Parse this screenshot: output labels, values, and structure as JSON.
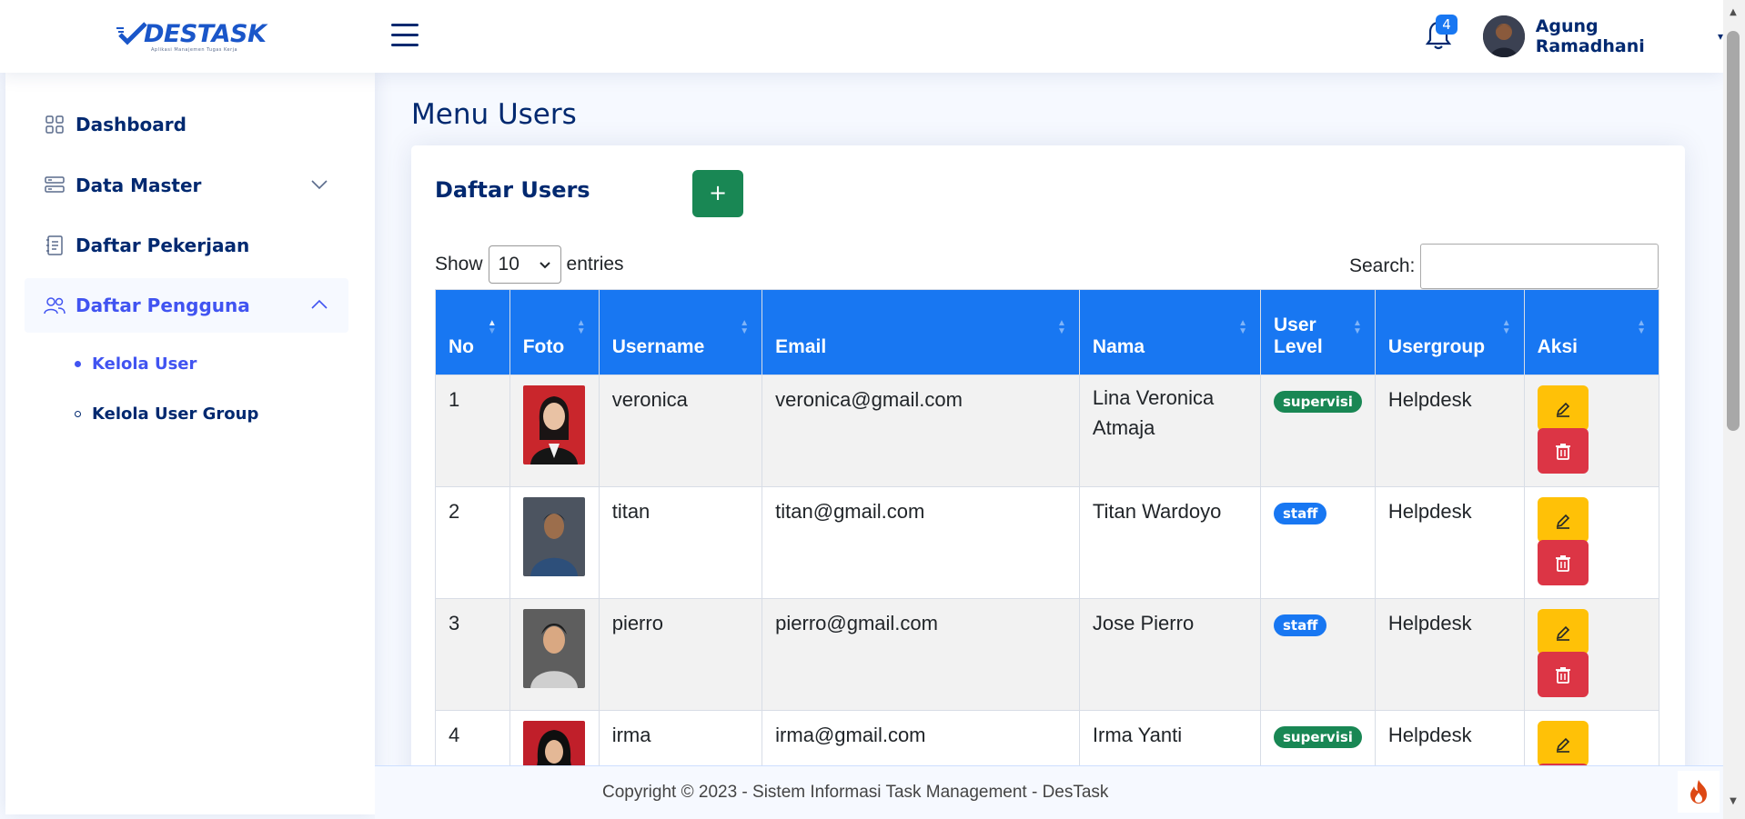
{
  "header": {
    "logo_text": "DESTASK",
    "logo_subtitle": "Aplikasi Manajemen Tugas Kerja",
    "notification_count": "4",
    "user_name": "Agung Ramadhani"
  },
  "sidebar": {
    "items": [
      {
        "label": "Dashboard",
        "icon": "grid-icon"
      },
      {
        "label": "Data Master",
        "icon": "server-icon"
      },
      {
        "label": "Daftar Pekerjaan",
        "icon": "journal-icon"
      },
      {
        "label": "Daftar Pengguna",
        "icon": "people-icon"
      }
    ],
    "sub_items": [
      {
        "label": "Kelola User",
        "active": true
      },
      {
        "label": "Kelola User Group",
        "active": false
      }
    ]
  },
  "main": {
    "page_title": "Menu Users",
    "card_title": "Daftar Users",
    "add_label": "+",
    "show_label": "Show",
    "show_value": "10",
    "entries_label": "entries",
    "search_label": "Search:"
  },
  "table": {
    "headers": [
      "No",
      "Foto",
      "Username",
      "Email",
      "Nama",
      "User Level",
      "Usergroup",
      "Aksi"
    ],
    "rows": [
      {
        "no": "1",
        "username": "veronica",
        "email": "veronica@gmail.com",
        "nama": "Lina Veronica Atmaja",
        "level": "supervisi",
        "group": "Helpdesk"
      },
      {
        "no": "2",
        "username": "titan",
        "email": "titan@gmail.com",
        "nama": "Titan Wardoyo",
        "level": "staff",
        "group": "Helpdesk"
      },
      {
        "no": "3",
        "username": "pierro",
        "email": "pierro@gmail.com",
        "nama": "Jose Pierro",
        "level": "staff",
        "group": "Helpdesk"
      },
      {
        "no": "4",
        "username": "irma",
        "email": "irma@gmail.com",
        "nama": "Irma Yanti",
        "level": "supervisi",
        "group": "Helpdesk"
      }
    ]
  },
  "footer": {
    "text": "Copyright © 2023 - Sistem Informasi Task Management - DesTask"
  },
  "colors": {
    "primary": "#1877f2",
    "navy": "#012970",
    "success": "#198754",
    "warning": "#ffc107",
    "danger": "#dc3545"
  }
}
